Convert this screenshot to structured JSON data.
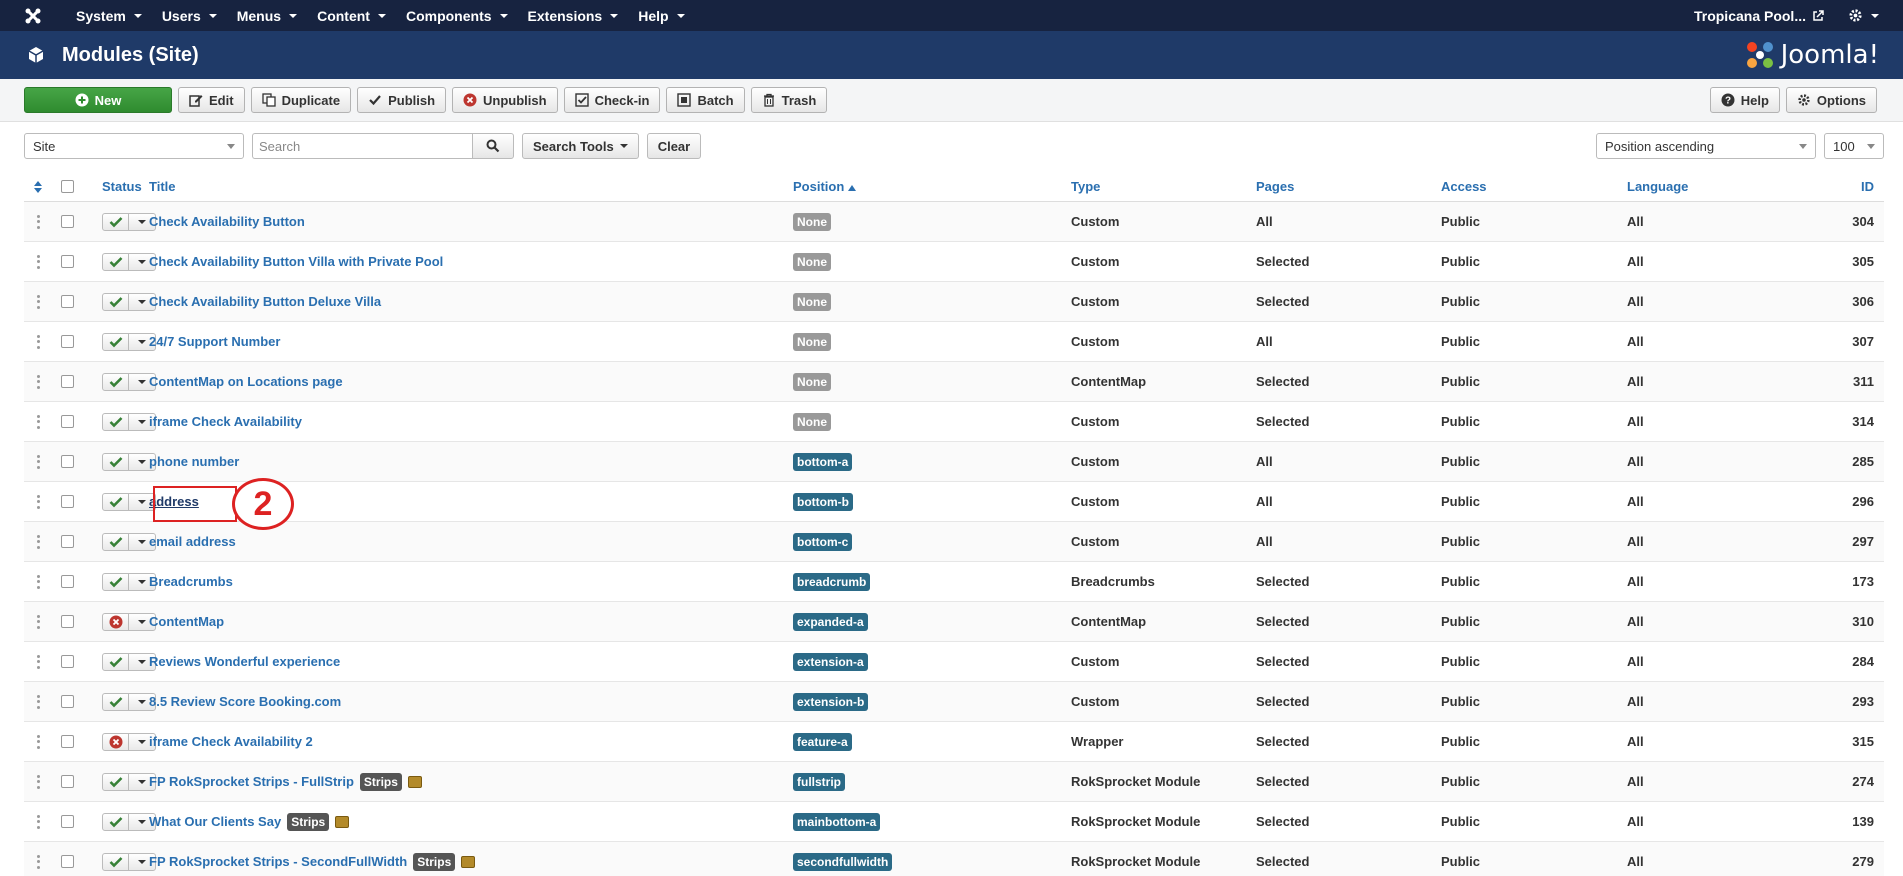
{
  "nav": {
    "items": [
      "System",
      "Users",
      "Menus",
      "Content",
      "Components",
      "Extensions",
      "Help"
    ],
    "site_link": "Tropicana Pool..."
  },
  "header": {
    "title": "Modules (Site)",
    "logo_text": "Joomla!"
  },
  "toolbar": {
    "new": "New",
    "edit": "Edit",
    "duplicate": "Duplicate",
    "publish": "Publish",
    "unpublish": "Unpublish",
    "checkin": "Check-in",
    "batch": "Batch",
    "trash": "Trash",
    "help": "Help",
    "options": "Options"
  },
  "filters": {
    "client": "Site",
    "search_placeholder": "Search",
    "search_tools": "Search Tools",
    "clear": "Clear",
    "ordering": "Position ascending",
    "limit": "100"
  },
  "table": {
    "headers": {
      "status": "Status",
      "title": "Title",
      "position": "Position",
      "type": "Type",
      "pages": "Pages",
      "access": "Access",
      "language": "Language",
      "id": "ID"
    },
    "rows": [
      {
        "published": true,
        "title": "Check Availability Button",
        "position": "None",
        "type": "Custom",
        "pages": "All",
        "access": "Public",
        "language": "All",
        "id": "304"
      },
      {
        "published": true,
        "title": "Check Availability Button Villa with Private Pool",
        "position": "None",
        "type": "Custom",
        "pages": "Selected",
        "access": "Public",
        "language": "All",
        "id": "305"
      },
      {
        "published": true,
        "title": "Check Availability Button Deluxe Villa",
        "position": "None",
        "type": "Custom",
        "pages": "Selected",
        "access": "Public",
        "language": "All",
        "id": "306"
      },
      {
        "published": true,
        "title": "24/7 Support Number",
        "position": "None",
        "type": "Custom",
        "pages": "All",
        "access": "Public",
        "language": "All",
        "id": "307"
      },
      {
        "published": true,
        "title": "ContentMap on Locations page",
        "position": "None",
        "type": "ContentMap",
        "pages": "Selected",
        "access": "Public",
        "language": "All",
        "id": "311"
      },
      {
        "published": true,
        "title": "iframe Check Availability",
        "position": "None",
        "type": "Custom",
        "pages": "Selected",
        "access": "Public",
        "language": "All",
        "id": "314"
      },
      {
        "published": true,
        "title": "phone number",
        "position": "bottom-a",
        "type": "Custom",
        "pages": "All",
        "access": "Public",
        "language": "All",
        "id": "285"
      },
      {
        "published": true,
        "title": "address",
        "position": "bottom-b",
        "type": "Custom",
        "pages": "All",
        "access": "Public",
        "language": "All",
        "id": "296"
      },
      {
        "published": true,
        "title": "email address",
        "position": "bottom-c",
        "type": "Custom",
        "pages": "All",
        "access": "Public",
        "language": "All",
        "id": "297"
      },
      {
        "published": true,
        "title": "Breadcrumbs",
        "position": "breadcrumb",
        "type": "Breadcrumbs",
        "pages": "Selected",
        "access": "Public",
        "language": "All",
        "id": "173"
      },
      {
        "published": false,
        "title": "ContentMap",
        "position": "expanded-a",
        "type": "ContentMap",
        "pages": "Selected",
        "access": "Public",
        "language": "All",
        "id": "310"
      },
      {
        "published": true,
        "title": "Reviews Wonderful experience",
        "position": "extension-a",
        "type": "Custom",
        "pages": "Selected",
        "access": "Public",
        "language": "All",
        "id": "284"
      },
      {
        "published": true,
        "title": "8.5 Review Score Booking.com",
        "position": "extension-b",
        "type": "Custom",
        "pages": "Selected",
        "access": "Public",
        "language": "All",
        "id": "293"
      },
      {
        "published": false,
        "title": "iframe Check Availability 2",
        "position": "feature-a",
        "type": "Wrapper",
        "pages": "Selected",
        "access": "Public",
        "language": "All",
        "id": "315"
      },
      {
        "published": true,
        "title": "FP RokSprocket Strips - FullStrip",
        "tag": "Strips",
        "position": "fullstrip",
        "type": "RokSprocket Module",
        "pages": "Selected",
        "access": "Public",
        "language": "All",
        "id": "274"
      },
      {
        "published": true,
        "title": "What Our Clients Say",
        "tag": "Strips",
        "position": "mainbottom-a",
        "type": "RokSprocket Module",
        "pages": "Selected",
        "access": "Public",
        "language": "All",
        "id": "139"
      },
      {
        "published": true,
        "title": "FP RokSprocket Strips - SecondFullWidth",
        "tag": "Strips",
        "position": "secondfullwidth",
        "type": "RokSprocket Module",
        "pages": "Selected",
        "access": "Public",
        "language": "All",
        "id": "279"
      }
    ]
  },
  "annotation": {
    "number": "2"
  },
  "colors": {
    "navbar": "#172340",
    "titlebar": "#1f3a68",
    "link": "#2a6fb0",
    "new_button": "#46a546",
    "callout": "#d22222"
  }
}
